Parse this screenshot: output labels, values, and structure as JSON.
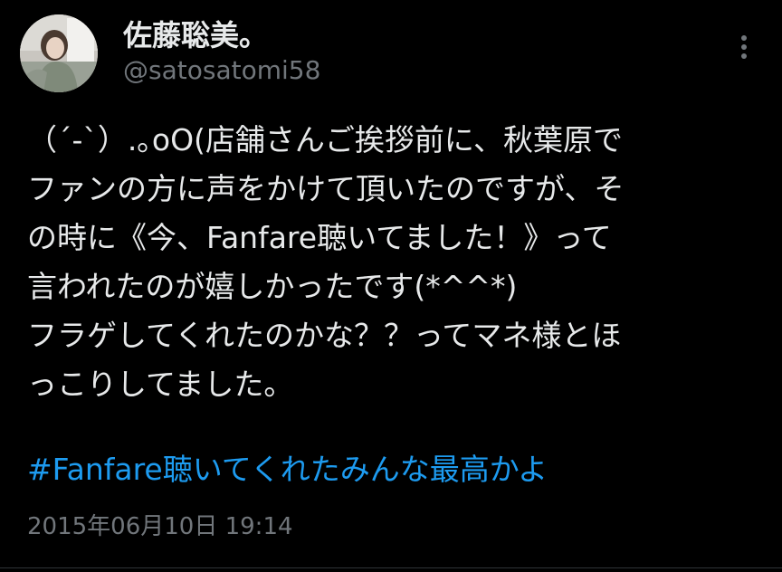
{
  "author": {
    "display_name": "佐藤聡美。",
    "handle": "@satosatomi58",
    "avatar_icon": "user-avatar-photo"
  },
  "menu": {
    "icon": "more-vertical-icon"
  },
  "tweet": {
    "lines": [
      "（´-`）.｡oO(店舗さんご挨拶前に、秋葉原で",
      "ファンの方に声をかけて頂いたのですが、そ",
      "の時に《今、Fanfare聴いてました！》って",
      "言われたのが嬉しかったです(*^^*)",
      "フラゲしてくれたのかな？？ってマネ様とほ",
      "っこりしてました。"
    ],
    "hashtag": "#Fanfare聴いてくれたみんな最高かよ",
    "timestamp": "2015年06月10日 19:14"
  },
  "colors": {
    "background": "#000000",
    "text": "#e7e9ea",
    "secondary": "#71767b",
    "link": "#1d9bf0"
  }
}
